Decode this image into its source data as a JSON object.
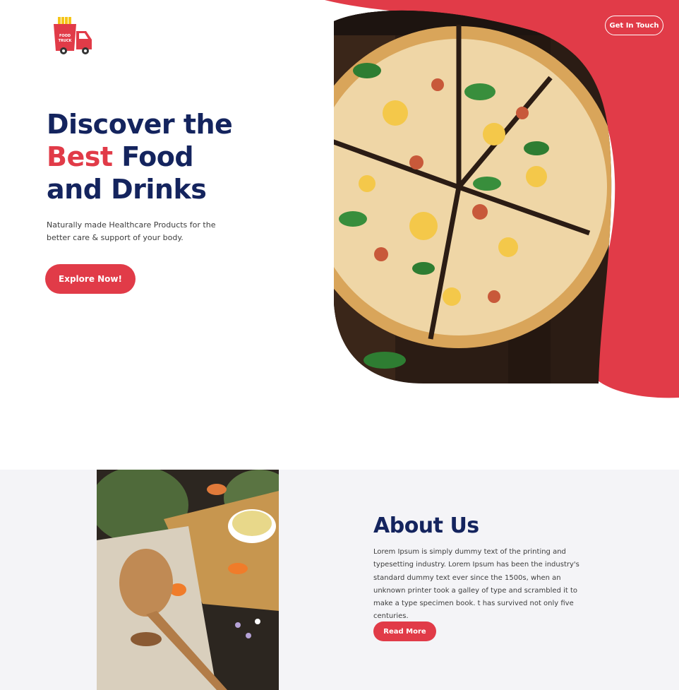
{
  "header": {
    "logo_text_line1": "FOOD",
    "logo_text_line2": "TRUCK",
    "cta_label": "Get In Touch"
  },
  "hero": {
    "title_line1": "Discover the",
    "title_accent": "Best",
    "title_line2_rest": "Food",
    "title_line3": "and Drinks",
    "subtitle": "Naturally made Healthcare Products for the better care & support of your body.",
    "button_label": "Explore Now!",
    "image_icon": "pizza-image"
  },
  "about": {
    "title": "About Us",
    "body": "Lorem Ipsum is simply dummy text of the printing and typesetting industry. Lorem Ipsum has been the industry's standard dummy text ever since the 1500s, when an unknown printer took a galley of type and scrambled it to make a type specimen book. t has survived not only five centuries.",
    "button_label": "Read More",
    "image_icon": "cooking-ingredients-image"
  },
  "colors": {
    "accent": "#e13b48",
    "navy": "#14245e",
    "section_bg": "#f4f4f7"
  }
}
